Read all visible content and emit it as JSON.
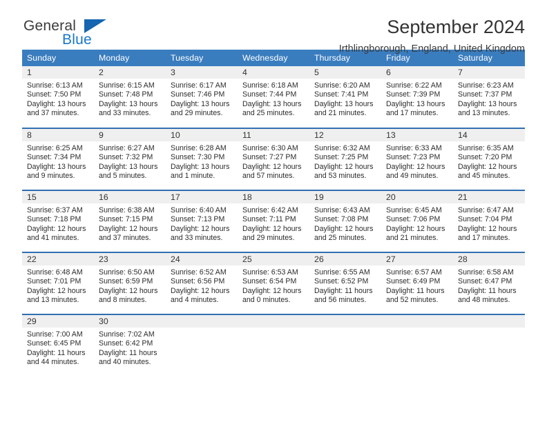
{
  "brand": {
    "name_top": "General",
    "name_bottom": "Blue",
    "triangle_color": "#1565b0",
    "blue_color": "#1877c9"
  },
  "header": {
    "title": "September 2024",
    "subtitle": "Irthlingborough, England, United Kingdom",
    "header_bg": "#3a7dbf",
    "daynum_bg": "#efefef",
    "row_border": "#2f6fb0"
  },
  "weekday_headers": [
    "Sunday",
    "Monday",
    "Tuesday",
    "Wednesday",
    "Thursday",
    "Friday",
    "Saturday"
  ],
  "labels": {
    "sunrise_prefix": "Sunrise: ",
    "sunset_prefix": "Sunset: ",
    "daylight_prefix": "Daylight: "
  },
  "weeks": [
    [
      {
        "day": "1",
        "sunrise": "Sunrise: 6:13 AM",
        "sunset": "Sunset: 7:50 PM",
        "daylight1": "Daylight: 13 hours",
        "daylight2": "and 37 minutes."
      },
      {
        "day": "2",
        "sunrise": "Sunrise: 6:15 AM",
        "sunset": "Sunset: 7:48 PM",
        "daylight1": "Daylight: 13 hours",
        "daylight2": "and 33 minutes."
      },
      {
        "day": "3",
        "sunrise": "Sunrise: 6:17 AM",
        "sunset": "Sunset: 7:46 PM",
        "daylight1": "Daylight: 13 hours",
        "daylight2": "and 29 minutes."
      },
      {
        "day": "4",
        "sunrise": "Sunrise: 6:18 AM",
        "sunset": "Sunset: 7:44 PM",
        "daylight1": "Daylight: 13 hours",
        "daylight2": "and 25 minutes."
      },
      {
        "day": "5",
        "sunrise": "Sunrise: 6:20 AM",
        "sunset": "Sunset: 7:41 PM",
        "daylight1": "Daylight: 13 hours",
        "daylight2": "and 21 minutes."
      },
      {
        "day": "6",
        "sunrise": "Sunrise: 6:22 AM",
        "sunset": "Sunset: 7:39 PM",
        "daylight1": "Daylight: 13 hours",
        "daylight2": "and 17 minutes."
      },
      {
        "day": "7",
        "sunrise": "Sunrise: 6:23 AM",
        "sunset": "Sunset: 7:37 PM",
        "daylight1": "Daylight: 13 hours",
        "daylight2": "and 13 minutes."
      }
    ],
    [
      {
        "day": "8",
        "sunrise": "Sunrise: 6:25 AM",
        "sunset": "Sunset: 7:34 PM",
        "daylight1": "Daylight: 13 hours",
        "daylight2": "and 9 minutes."
      },
      {
        "day": "9",
        "sunrise": "Sunrise: 6:27 AM",
        "sunset": "Sunset: 7:32 PM",
        "daylight1": "Daylight: 13 hours",
        "daylight2": "and 5 minutes."
      },
      {
        "day": "10",
        "sunrise": "Sunrise: 6:28 AM",
        "sunset": "Sunset: 7:30 PM",
        "daylight1": "Daylight: 13 hours",
        "daylight2": "and 1 minute."
      },
      {
        "day": "11",
        "sunrise": "Sunrise: 6:30 AM",
        "sunset": "Sunset: 7:27 PM",
        "daylight1": "Daylight: 12 hours",
        "daylight2": "and 57 minutes."
      },
      {
        "day": "12",
        "sunrise": "Sunrise: 6:32 AM",
        "sunset": "Sunset: 7:25 PM",
        "daylight1": "Daylight: 12 hours",
        "daylight2": "and 53 minutes."
      },
      {
        "day": "13",
        "sunrise": "Sunrise: 6:33 AM",
        "sunset": "Sunset: 7:23 PM",
        "daylight1": "Daylight: 12 hours",
        "daylight2": "and 49 minutes."
      },
      {
        "day": "14",
        "sunrise": "Sunrise: 6:35 AM",
        "sunset": "Sunset: 7:20 PM",
        "daylight1": "Daylight: 12 hours",
        "daylight2": "and 45 minutes."
      }
    ],
    [
      {
        "day": "15",
        "sunrise": "Sunrise: 6:37 AM",
        "sunset": "Sunset: 7:18 PM",
        "daylight1": "Daylight: 12 hours",
        "daylight2": "and 41 minutes."
      },
      {
        "day": "16",
        "sunrise": "Sunrise: 6:38 AM",
        "sunset": "Sunset: 7:15 PM",
        "daylight1": "Daylight: 12 hours",
        "daylight2": "and 37 minutes."
      },
      {
        "day": "17",
        "sunrise": "Sunrise: 6:40 AM",
        "sunset": "Sunset: 7:13 PM",
        "daylight1": "Daylight: 12 hours",
        "daylight2": "and 33 minutes."
      },
      {
        "day": "18",
        "sunrise": "Sunrise: 6:42 AM",
        "sunset": "Sunset: 7:11 PM",
        "daylight1": "Daylight: 12 hours",
        "daylight2": "and 29 minutes."
      },
      {
        "day": "19",
        "sunrise": "Sunrise: 6:43 AM",
        "sunset": "Sunset: 7:08 PM",
        "daylight1": "Daylight: 12 hours",
        "daylight2": "and 25 minutes."
      },
      {
        "day": "20",
        "sunrise": "Sunrise: 6:45 AM",
        "sunset": "Sunset: 7:06 PM",
        "daylight1": "Daylight: 12 hours",
        "daylight2": "and 21 minutes."
      },
      {
        "day": "21",
        "sunrise": "Sunrise: 6:47 AM",
        "sunset": "Sunset: 7:04 PM",
        "daylight1": "Daylight: 12 hours",
        "daylight2": "and 17 minutes."
      }
    ],
    [
      {
        "day": "22",
        "sunrise": "Sunrise: 6:48 AM",
        "sunset": "Sunset: 7:01 PM",
        "daylight1": "Daylight: 12 hours",
        "daylight2": "and 13 minutes."
      },
      {
        "day": "23",
        "sunrise": "Sunrise: 6:50 AM",
        "sunset": "Sunset: 6:59 PM",
        "daylight1": "Daylight: 12 hours",
        "daylight2": "and 8 minutes."
      },
      {
        "day": "24",
        "sunrise": "Sunrise: 6:52 AM",
        "sunset": "Sunset: 6:56 PM",
        "daylight1": "Daylight: 12 hours",
        "daylight2": "and 4 minutes."
      },
      {
        "day": "25",
        "sunrise": "Sunrise: 6:53 AM",
        "sunset": "Sunset: 6:54 PM",
        "daylight1": "Daylight: 12 hours",
        "daylight2": "and 0 minutes."
      },
      {
        "day": "26",
        "sunrise": "Sunrise: 6:55 AM",
        "sunset": "Sunset: 6:52 PM",
        "daylight1": "Daylight: 11 hours",
        "daylight2": "and 56 minutes."
      },
      {
        "day": "27",
        "sunrise": "Sunrise: 6:57 AM",
        "sunset": "Sunset: 6:49 PM",
        "daylight1": "Daylight: 11 hours",
        "daylight2": "and 52 minutes."
      },
      {
        "day": "28",
        "sunrise": "Sunrise: 6:58 AM",
        "sunset": "Sunset: 6:47 PM",
        "daylight1": "Daylight: 11 hours",
        "daylight2": "and 48 minutes."
      }
    ],
    [
      {
        "day": "29",
        "sunrise": "Sunrise: 7:00 AM",
        "sunset": "Sunset: 6:45 PM",
        "daylight1": "Daylight: 11 hours",
        "daylight2": "and 44 minutes."
      },
      {
        "day": "30",
        "sunrise": "Sunrise: 7:02 AM",
        "sunset": "Sunset: 6:42 PM",
        "daylight1": "Daylight: 11 hours",
        "daylight2": "and 40 minutes."
      },
      {
        "day": "",
        "sunrise": "",
        "sunset": "",
        "daylight1": "",
        "daylight2": ""
      },
      {
        "day": "",
        "sunrise": "",
        "sunset": "",
        "daylight1": "",
        "daylight2": ""
      },
      {
        "day": "",
        "sunrise": "",
        "sunset": "",
        "daylight1": "",
        "daylight2": ""
      },
      {
        "day": "",
        "sunrise": "",
        "sunset": "",
        "daylight1": "",
        "daylight2": ""
      },
      {
        "day": "",
        "sunrise": "",
        "sunset": "",
        "daylight1": "",
        "daylight2": ""
      }
    ]
  ]
}
